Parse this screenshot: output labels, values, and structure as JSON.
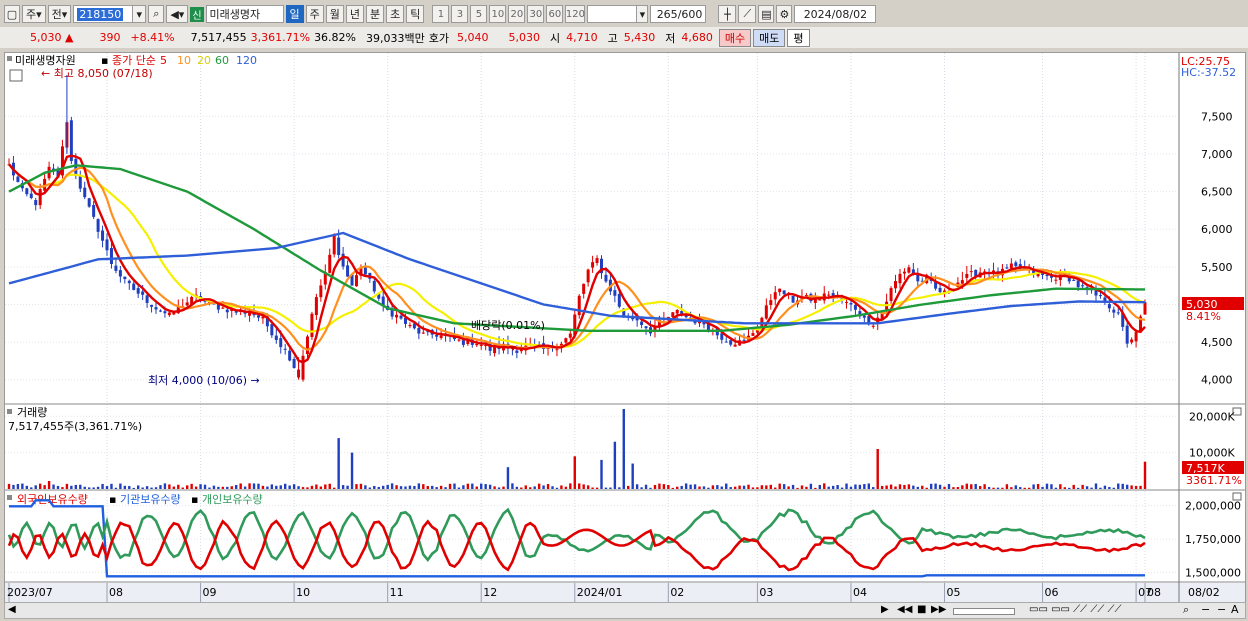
{
  "toolbar": {
    "market": "주",
    "type": "전",
    "code": "218150",
    "stock_name": "미래생명자",
    "new_badge": "신",
    "periods": [
      "일",
      "주",
      "월",
      "년",
      "분",
      "초",
      "틱"
    ],
    "selected_period": "일",
    "intervals": [
      "1",
      "3",
      "5",
      "10",
      "20",
      "30",
      "60",
      "120"
    ],
    "count": "265",
    "count_total": "/600",
    "date": "2024/08/02"
  },
  "info": {
    "price": "5,030",
    "change": "390",
    "change_pct": "+8.41%",
    "volume": "7,517,455",
    "volume_ratio": "3,361.71%",
    "turnover": "36.82%",
    "amount": "39,033백만",
    "ask_label": "호가",
    "ask": "5,040",
    "bid": "5,030",
    "open_label": "시",
    "open": "4,710",
    "high_label": "고",
    "high": "5,430",
    "low_label": "저",
    "low": "4,680",
    "buy_btn": "매수",
    "sell_btn": "매도",
    "eval_btn": "평"
  },
  "colors": {
    "up": "#e00000",
    "down": "#1f3fbf",
    "ma5": "#e00000",
    "ma10": "#ff9020",
    "ma20": "#f5f000",
    "ma60": "#1f9a3a",
    "ma120": "#2f5fd8",
    "foreign": "#e00000",
    "inst": "#1f5fe0",
    "indiv": "#2f9a5a"
  },
  "price_panel": {
    "title": "미래생명자원",
    "legend_prefix": "종가 단순",
    "ma_labels": [
      "5",
      "10",
      "20",
      "60",
      "120"
    ],
    "max_label": "최고 8,050 (07/18)",
    "min_label": "최저 4,000 (10/06)",
    "dividend_label": "배당락(0.01%)",
    "lc_label": "LC:25.75",
    "hc_label": "HC:-37.52",
    "current_price": "5,030",
    "current_pct": "8.41%",
    "y_ticks": [
      "7,500",
      "7,000",
      "6,500",
      "6,000",
      "5,500",
      "5,000",
      "4,500",
      "4,000"
    ]
  },
  "volume_panel": {
    "title": "거래량",
    "current": "7,517,455주(3,361.71%)",
    "current_tag": "7,517K",
    "current_pct": "3361.71%",
    "y_ticks": [
      "20,000K",
      "10,000K"
    ]
  },
  "holding_panel": {
    "legend": [
      "외국인보유수량",
      "기관보유수량",
      "개인보유수량"
    ],
    "y_ticks": [
      "2,000,000",
      "1,750,000",
      "1,500,000"
    ]
  },
  "x_axis": {
    "labels": [
      "2023/07",
      "08",
      "09",
      "10",
      "11",
      "12",
      "2024/01",
      "02",
      "03",
      "04",
      "05",
      "06",
      "07",
      "08"
    ],
    "right_label": "08/02"
  },
  "chart_data": {
    "type": "candlestick",
    "x_start": "2023/07/03",
    "x_end": "2024/08/02",
    "price_ylim": [
      3850,
      8050
    ],
    "price_anchors": [
      [
        0,
        6850
      ],
      [
        3,
        6500
      ],
      [
        6,
        6350
      ],
      [
        9,
        6800
      ],
      [
        11,
        6700
      ],
      [
        13,
        7450
      ],
      [
        14,
        6900
      ],
      [
        17,
        6400
      ],
      [
        20,
        6000
      ],
      [
        23,
        5550
      ],
      [
        26,
        5300
      ],
      [
        30,
        5100
      ],
      [
        33,
        4950
      ],
      [
        36,
        4850
      ],
      [
        39,
        5000
      ],
      [
        42,
        5100
      ],
      [
        45,
        5000
      ],
      [
        48,
        4950
      ],
      [
        51,
        4900
      ],
      [
        54,
        4900
      ],
      [
        57,
        4800
      ],
      [
        60,
        4550
      ],
      [
        63,
        4300
      ],
      [
        65,
        4050
      ],
      [
        67,
        4600
      ],
      [
        69,
        5100
      ],
      [
        71,
        5400
      ],
      [
        73,
        5900
      ],
      [
        75,
        5500
      ],
      [
        77,
        5250
      ],
      [
        79,
        5500
      ],
      [
        82,
        5200
      ],
      [
        84,
        4950
      ],
      [
        87,
        4850
      ],
      [
        90,
        4700
      ],
      [
        93,
        4600
      ],
      [
        96,
        4600
      ],
      [
        99,
        4550
      ],
      [
        102,
        4500
      ],
      [
        105,
        4500
      ],
      [
        108,
        4400
      ],
      [
        111,
        4450
      ],
      [
        114,
        4400
      ],
      [
        117,
        4450
      ],
      [
        120,
        4400
      ],
      [
        123,
        4450
      ],
      [
        126,
        4600
      ],
      [
        128,
        5100
      ],
      [
        130,
        5450
      ],
      [
        132,
        5600
      ],
      [
        134,
        5300
      ],
      [
        136,
        5100
      ],
      [
        138,
        4850
      ],
      [
        141,
        4800
      ],
      [
        144,
        4650
      ],
      [
        147,
        4800
      ],
      [
        150,
        4900
      ],
      [
        153,
        4800
      ],
      [
        156,
        4750
      ],
      [
        159,
        4600
      ],
      [
        162,
        4500
      ],
      [
        165,
        4500
      ],
      [
        168,
        4700
      ],
      [
        170,
        4950
      ],
      [
        172,
        5200
      ],
      [
        174,
        5150
      ],
      [
        176,
        5050
      ],
      [
        178,
        5100
      ],
      [
        181,
        5050
      ],
      [
        184,
        5150
      ],
      [
        187,
        5050
      ],
      [
        190,
        4950
      ],
      [
        192,
        4800
      ],
      [
        194,
        4750
      ],
      [
        196,
        4900
      ],
      [
        198,
        5200
      ],
      [
        200,
        5400
      ],
      [
        202,
        5500
      ],
      [
        204,
        5300
      ],
      [
        206,
        5350
      ],
      [
        208,
        5200
      ],
      [
        210,
        5150
      ],
      [
        213,
        5300
      ],
      [
        216,
        5400
      ],
      [
        219,
        5450
      ],
      [
        222,
        5400
      ],
      [
        225,
        5500
      ],
      [
        228,
        5450
      ],
      [
        231,
        5400
      ],
      [
        234,
        5350
      ],
      [
        237,
        5400
      ],
      [
        240,
        5250
      ],
      [
        243,
        5150
      ],
      [
        246,
        5050
      ],
      [
        249,
        4850
      ],
      [
        251,
        4500
      ],
      [
        253,
        4600
      ],
      [
        255,
        5030
      ]
    ],
    "ma120_anchors": [
      [
        0,
        5280
      ],
      [
        20,
        5600
      ],
      [
        40,
        5650
      ],
      [
        60,
        5750
      ],
      [
        75,
        5950
      ],
      [
        90,
        5600
      ],
      [
        105,
        5300
      ],
      [
        120,
        5000
      ],
      [
        135,
        4850
      ],
      [
        150,
        4800
      ],
      [
        165,
        4750
      ],
      [
        180,
        4750
      ],
      [
        195,
        4750
      ],
      [
        210,
        4870
      ],
      [
        225,
        4980
      ],
      [
        240,
        5040
      ],
      [
        255,
        5030
      ]
    ],
    "ma60_anchors": [
      [
        0,
        6500
      ],
      [
        8,
        6750
      ],
      [
        15,
        6850
      ],
      [
        25,
        6800
      ],
      [
        40,
        6500
      ],
      [
        55,
        6000
      ],
      [
        70,
        5450
      ],
      [
        85,
        4950
      ],
      [
        100,
        4750
      ],
      [
        115,
        4700
      ],
      [
        130,
        4650
      ],
      [
        145,
        4650
      ],
      [
        160,
        4650
      ],
      [
        175,
        4730
      ],
      [
        190,
        4850
      ],
      [
        205,
        5000
      ],
      [
        220,
        5120
      ],
      [
        235,
        5210
      ],
      [
        255,
        5200
      ]
    ],
    "volume_spikes": [
      [
        9,
        2.2
      ],
      [
        74,
        14
      ],
      [
        77,
        10
      ],
      [
        112,
        6
      ],
      [
        127,
        9
      ],
      [
        133,
        8
      ],
      [
        136,
        13
      ],
      [
        138,
        22
      ],
      [
        140,
        7
      ],
      [
        195,
        11
      ],
      [
        255,
        7.5
      ]
    ],
    "volume_ylim": [
      0,
      22
    ],
    "holding_ylim": [
      1450000,
      2050000
    ],
    "series": [
      {
        "name": "외국인보유수량"
      },
      {
        "name": "기관보유수량"
      },
      {
        "name": "개인보유수량"
      }
    ]
  }
}
